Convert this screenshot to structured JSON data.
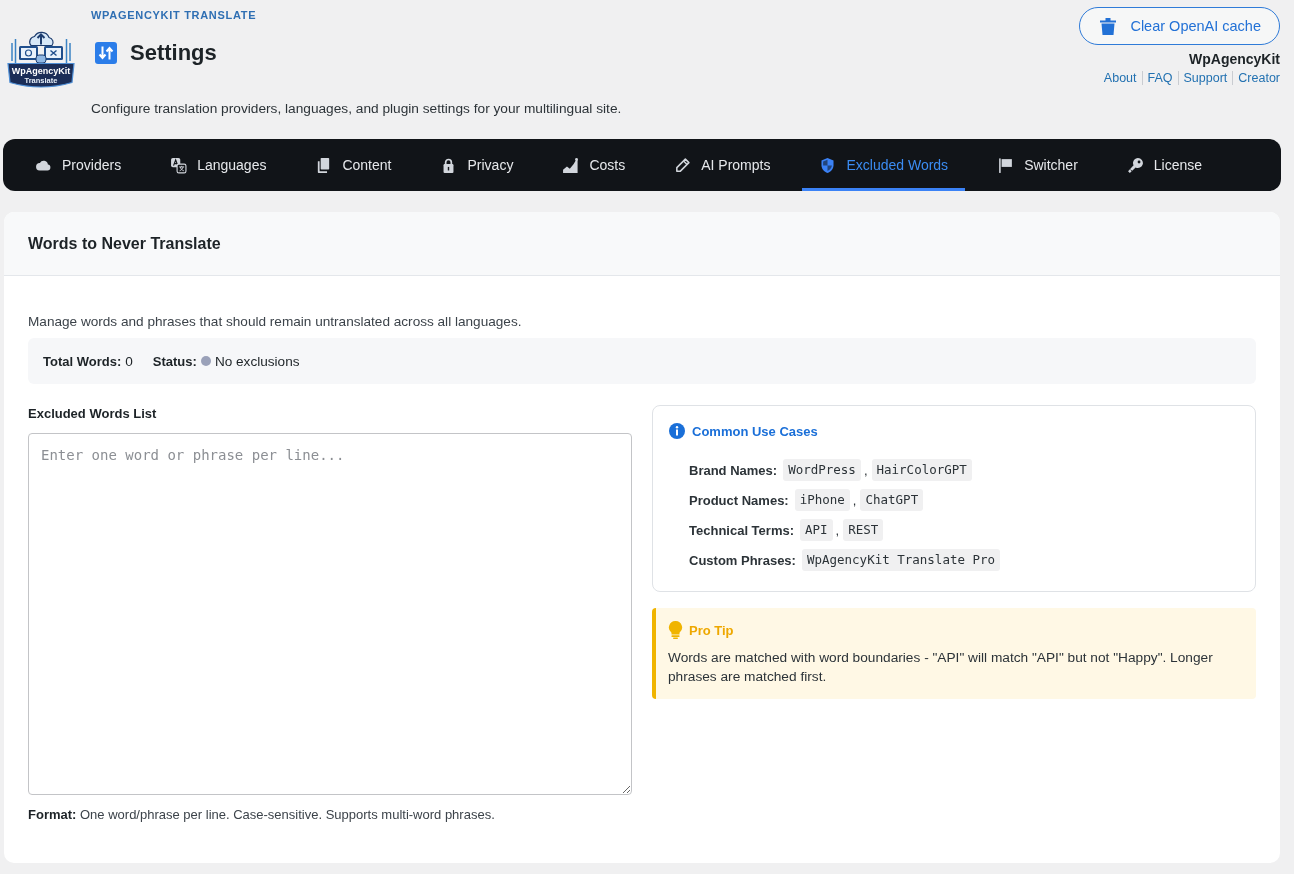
{
  "header": {
    "logo": {
      "name": "WpAgencyKit",
      "tagline": "Translate"
    },
    "brand": "WPAGENCYKIT TRANSLATE",
    "title": "Settings",
    "description": "Configure translation providers, languages, and plugin settings for your multilingual site.",
    "cache_button": "Clear OpenAI cache",
    "vendor": "WpAgencyKit",
    "links": [
      "About",
      "FAQ",
      "Support",
      "Creator"
    ]
  },
  "nav": {
    "tabs": [
      {
        "label": "Providers",
        "selected": false
      },
      {
        "label": "Languages",
        "selected": false
      },
      {
        "label": "Content",
        "selected": false
      },
      {
        "label": "Privacy",
        "selected": false
      },
      {
        "label": "Costs",
        "selected": false
      },
      {
        "label": "AI Prompts",
        "selected": false
      },
      {
        "label": "Excluded Words",
        "selected": true
      },
      {
        "label": "Switcher",
        "selected": false
      },
      {
        "label": "License",
        "selected": false
      }
    ]
  },
  "panel": {
    "title": "Words to Never Translate",
    "description": "Manage words and phrases that should remain untranslated across all languages.",
    "stats": [
      {
        "label": "Total Words:",
        "value": "0"
      },
      {
        "label": "Status:",
        "value": "No exclusions",
        "color": "#9aa1b9"
      }
    ],
    "editor": {
      "label": "Excluded Words List",
      "placeholder": "Enter one word or phrase per line...",
      "note": "**Format:** One word/phrase per line. Case-sensitive. Supports multi-word phrases."
    },
    "use_cases": {
      "title": "Common Use Cases",
      "rows": [
        {
          "label": "Brand Names:",
          "parts": [
            {
              "kind": "code",
              "text": "WordPress"
            },
            {
              "kind": "plain",
              "text": ","
            },
            {
              "kind": "code",
              "text": "HairColorGPT"
            }
          ]
        },
        {
          "label": "Product Names:",
          "parts": [
            {
              "kind": "code",
              "text": "iPhone"
            },
            {
              "kind": "plain",
              "text": ","
            },
            {
              "kind": "code",
              "text": "ChatGPT"
            }
          ]
        },
        {
          "label": "Technical Terms:",
          "parts": [
            {
              "kind": "code",
              "text": "API"
            },
            {
              "kind": "plain",
              "text": ","
            },
            {
              "kind": "code",
              "text": "REST"
            }
          ]
        },
        {
          "label": "Custom Phrases:",
          "parts": [
            {
              "kind": "code",
              "text": "WpAgencyKit Translate Pro"
            }
          ]
        }
      ]
    },
    "tip": {
      "title": "Pro Tip",
      "text": "Words are matched with word boundaries - \"API\" will match \"API\" but not \"Happy\". Longer phrases are matched first."
    }
  }
}
